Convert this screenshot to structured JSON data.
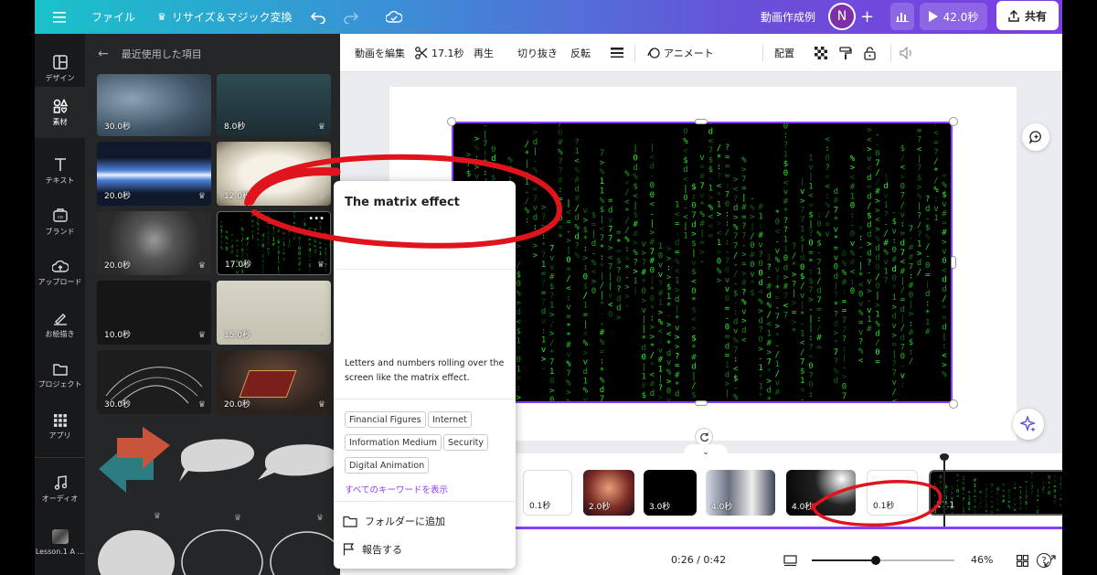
{
  "topbar": {
    "file_label": "ファイル",
    "resize_label": "リサイズ＆マジック変換",
    "doc_title": "動画作成例",
    "avatar_initial": "N",
    "duration_label": "42.0秒",
    "share_label": "共有"
  },
  "rail": {
    "items": [
      {
        "label": "デザイン",
        "icon": "layout-icon"
      },
      {
        "label": "素材",
        "icon": "elements-icon"
      },
      {
        "label": "テキスト",
        "icon": "text-icon"
      },
      {
        "label": "ブランド",
        "icon": "brand-icon"
      },
      {
        "label": "アップロード",
        "icon": "upload-icon"
      },
      {
        "label": "お絵描き",
        "icon": "draw-icon"
      },
      {
        "label": "プロジェクト",
        "icon": "folder-icon"
      },
      {
        "label": "アプリ",
        "icon": "apps-icon"
      },
      {
        "label": "オーディオ",
        "icon": "music-icon"
      },
      {
        "label": "Lesson.1 A ...",
        "icon": "lesson-thumbnail"
      }
    ]
  },
  "panel": {
    "heading": "最近使用した項目",
    "thumbs": [
      {
        "duration": "30.0秒"
      },
      {
        "duration": "8.0秒"
      },
      {
        "duration": "20.0秒"
      },
      {
        "duration": "12.0秒"
      },
      {
        "duration": "20.0秒"
      },
      {
        "duration": "17.0秒"
      },
      {
        "duration": "10.0秒"
      },
      {
        "duration": "15.0秒"
      },
      {
        "duration": "30.0秒"
      },
      {
        "duration": "20.0秒"
      }
    ]
  },
  "toolbar": {
    "edit_video": "動画を編集",
    "trim_duration": "17.1秒",
    "playback": "再生",
    "crop": "切り抜き",
    "flip": "反転",
    "animate": "アニメート",
    "position": "配置"
  },
  "popup": {
    "title": "The matrix effect",
    "description": "Letters and numbers rolling over the screen like the matrix effect.",
    "keywords": [
      "Financial Figures",
      "Internet",
      "Information Medium",
      "Security",
      "Digital Animation"
    ],
    "show_all_keywords": "すべてのキーワードを表示",
    "add_to_folder": "フォルダーに追加",
    "report": "報告する"
  },
  "timeline": {
    "clips": [
      {
        "duration": "0.1秒"
      },
      {
        "duration": "2.0秒"
      },
      {
        "duration": "3.0秒"
      },
      {
        "duration": "4.0秒"
      },
      {
        "duration": "4.0秒"
      },
      {
        "duration": "0.1秒"
      },
      {
        "duration": "17.1"
      }
    ],
    "time": "0:26 / 0:42",
    "zoom": "46%",
    "zoom_level": 0.45
  },
  "colors": {
    "accent": "#8b3dff",
    "annotation": "#e0141c",
    "matrix_green": "#2dff2d"
  }
}
